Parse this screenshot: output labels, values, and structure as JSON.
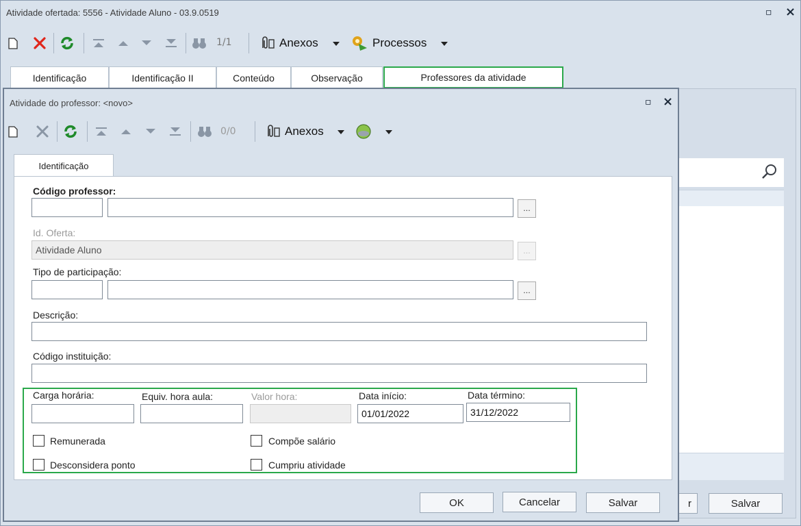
{
  "outer": {
    "title": "Atividade ofertada: 5556 - Atividade Aluno  - 03.9.0519",
    "controls": {
      "maximize": "▫",
      "close": "×"
    },
    "toolbar": {
      "record_count": "1/1",
      "anexos_label": "Anexos",
      "processos_label": "Processos"
    },
    "tabs": [
      "Identificação",
      "Identificação II",
      "Conteúdo",
      "Observação",
      "Professores da atividade"
    ],
    "buttons": {
      "partial": "r",
      "save": "Salvar"
    }
  },
  "inner": {
    "title": "Atividade do professor: <novo>",
    "controls": {
      "maximize": "▫",
      "close": "×"
    },
    "toolbar": {
      "record_count": "0/0",
      "anexos_label": "Anexos"
    },
    "tab": "Identificação",
    "form": {
      "codigo_professor_label": "Código professor:",
      "codigo_professor_code": "",
      "codigo_professor_name": "",
      "id_oferta_label": "Id. Oferta:",
      "id_oferta_value": "Atividade Aluno",
      "tipo_participacao_label": "Tipo de participação:",
      "tipo_participacao_code": "",
      "tipo_participacao_name": "",
      "descricao_label": "Descrição:",
      "descricao_value": "",
      "codigo_instituicao_label": "Código instituição:",
      "codigo_instituicao_value": "",
      "carga_horaria_label": "Carga horária:",
      "carga_horaria_value": "",
      "equiv_hora_aula_label": "Equiv. hora aula:",
      "equiv_hora_aula_value": "",
      "valor_hora_label": "Valor hora:",
      "valor_hora_value": "",
      "data_inicio_label": "Data início:",
      "data_inicio_value": "01/01/2022",
      "data_termino_label": "Data término:",
      "data_termino_value": "31/12/2022",
      "ellipsis": "...",
      "checkboxes": {
        "remunerada": "Remunerada",
        "compoe_salario": "Compõe salário",
        "desconsidera_ponto": "Desconsidera ponto",
        "cumpriu_atividade": "Cumpriu atividade"
      }
    },
    "buttons": {
      "ok": "OK",
      "cancel": "Cancelar",
      "save": "Salvar"
    }
  },
  "colors": {
    "highlight": "#2aa84a",
    "delete_red": "#e0261b",
    "refresh_green": "#1f8a2a"
  }
}
